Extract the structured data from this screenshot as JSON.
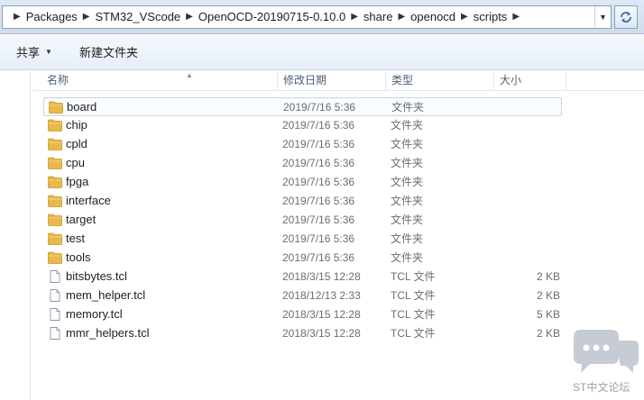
{
  "address_bar": {
    "crumbs": [
      "Packages",
      "STM32_VScode",
      "OpenOCD-20190715-0.10.0",
      "share",
      "openocd",
      "scripts"
    ]
  },
  "toolbar": {
    "share_label": "共享",
    "new_folder_label": "新建文件夹"
  },
  "columns": {
    "name": "名称",
    "date": "修改日期",
    "type": "类型",
    "size": "大小"
  },
  "files": [
    {
      "name": "board",
      "date": "2019/7/16 5:36",
      "type": "文件夹",
      "size": "",
      "kind": "folder",
      "selected": true
    },
    {
      "name": "chip",
      "date": "2019/7/16 5:36",
      "type": "文件夹",
      "size": "",
      "kind": "folder"
    },
    {
      "name": "cpld",
      "date": "2019/7/16 5:36",
      "type": "文件夹",
      "size": "",
      "kind": "folder"
    },
    {
      "name": "cpu",
      "date": "2019/7/16 5:36",
      "type": "文件夹",
      "size": "",
      "kind": "folder"
    },
    {
      "name": "fpga",
      "date": "2019/7/16 5:36",
      "type": "文件夹",
      "size": "",
      "kind": "folder"
    },
    {
      "name": "interface",
      "date": "2019/7/16 5:36",
      "type": "文件夹",
      "size": "",
      "kind": "folder"
    },
    {
      "name": "target",
      "date": "2019/7/16 5:36",
      "type": "文件夹",
      "size": "",
      "kind": "folder"
    },
    {
      "name": "test",
      "date": "2019/7/16 5:36",
      "type": "文件夹",
      "size": "",
      "kind": "folder"
    },
    {
      "name": "tools",
      "date": "2019/7/16 5:36",
      "type": "文件夹",
      "size": "",
      "kind": "folder"
    },
    {
      "name": "bitsbytes.tcl",
      "date": "2018/3/15 12:28",
      "type": "TCL 文件",
      "size": "2 KB",
      "kind": "file"
    },
    {
      "name": "mem_helper.tcl",
      "date": "2018/12/13 2:33",
      "type": "TCL 文件",
      "size": "2 KB",
      "kind": "file"
    },
    {
      "name": "memory.tcl",
      "date": "2018/3/15 12:28",
      "type": "TCL 文件",
      "size": "5 KB",
      "kind": "file"
    },
    {
      "name": "mmr_helpers.tcl",
      "date": "2018/3/15 12:28",
      "type": "TCL 文件",
      "size": "2 KB",
      "kind": "file"
    }
  ],
  "watermark": {
    "text": "ST中文论坛"
  },
  "colors": {
    "folder": "#e8b84a",
    "selection_border": "#c5d6ea",
    "header_text": "#4c607a"
  }
}
